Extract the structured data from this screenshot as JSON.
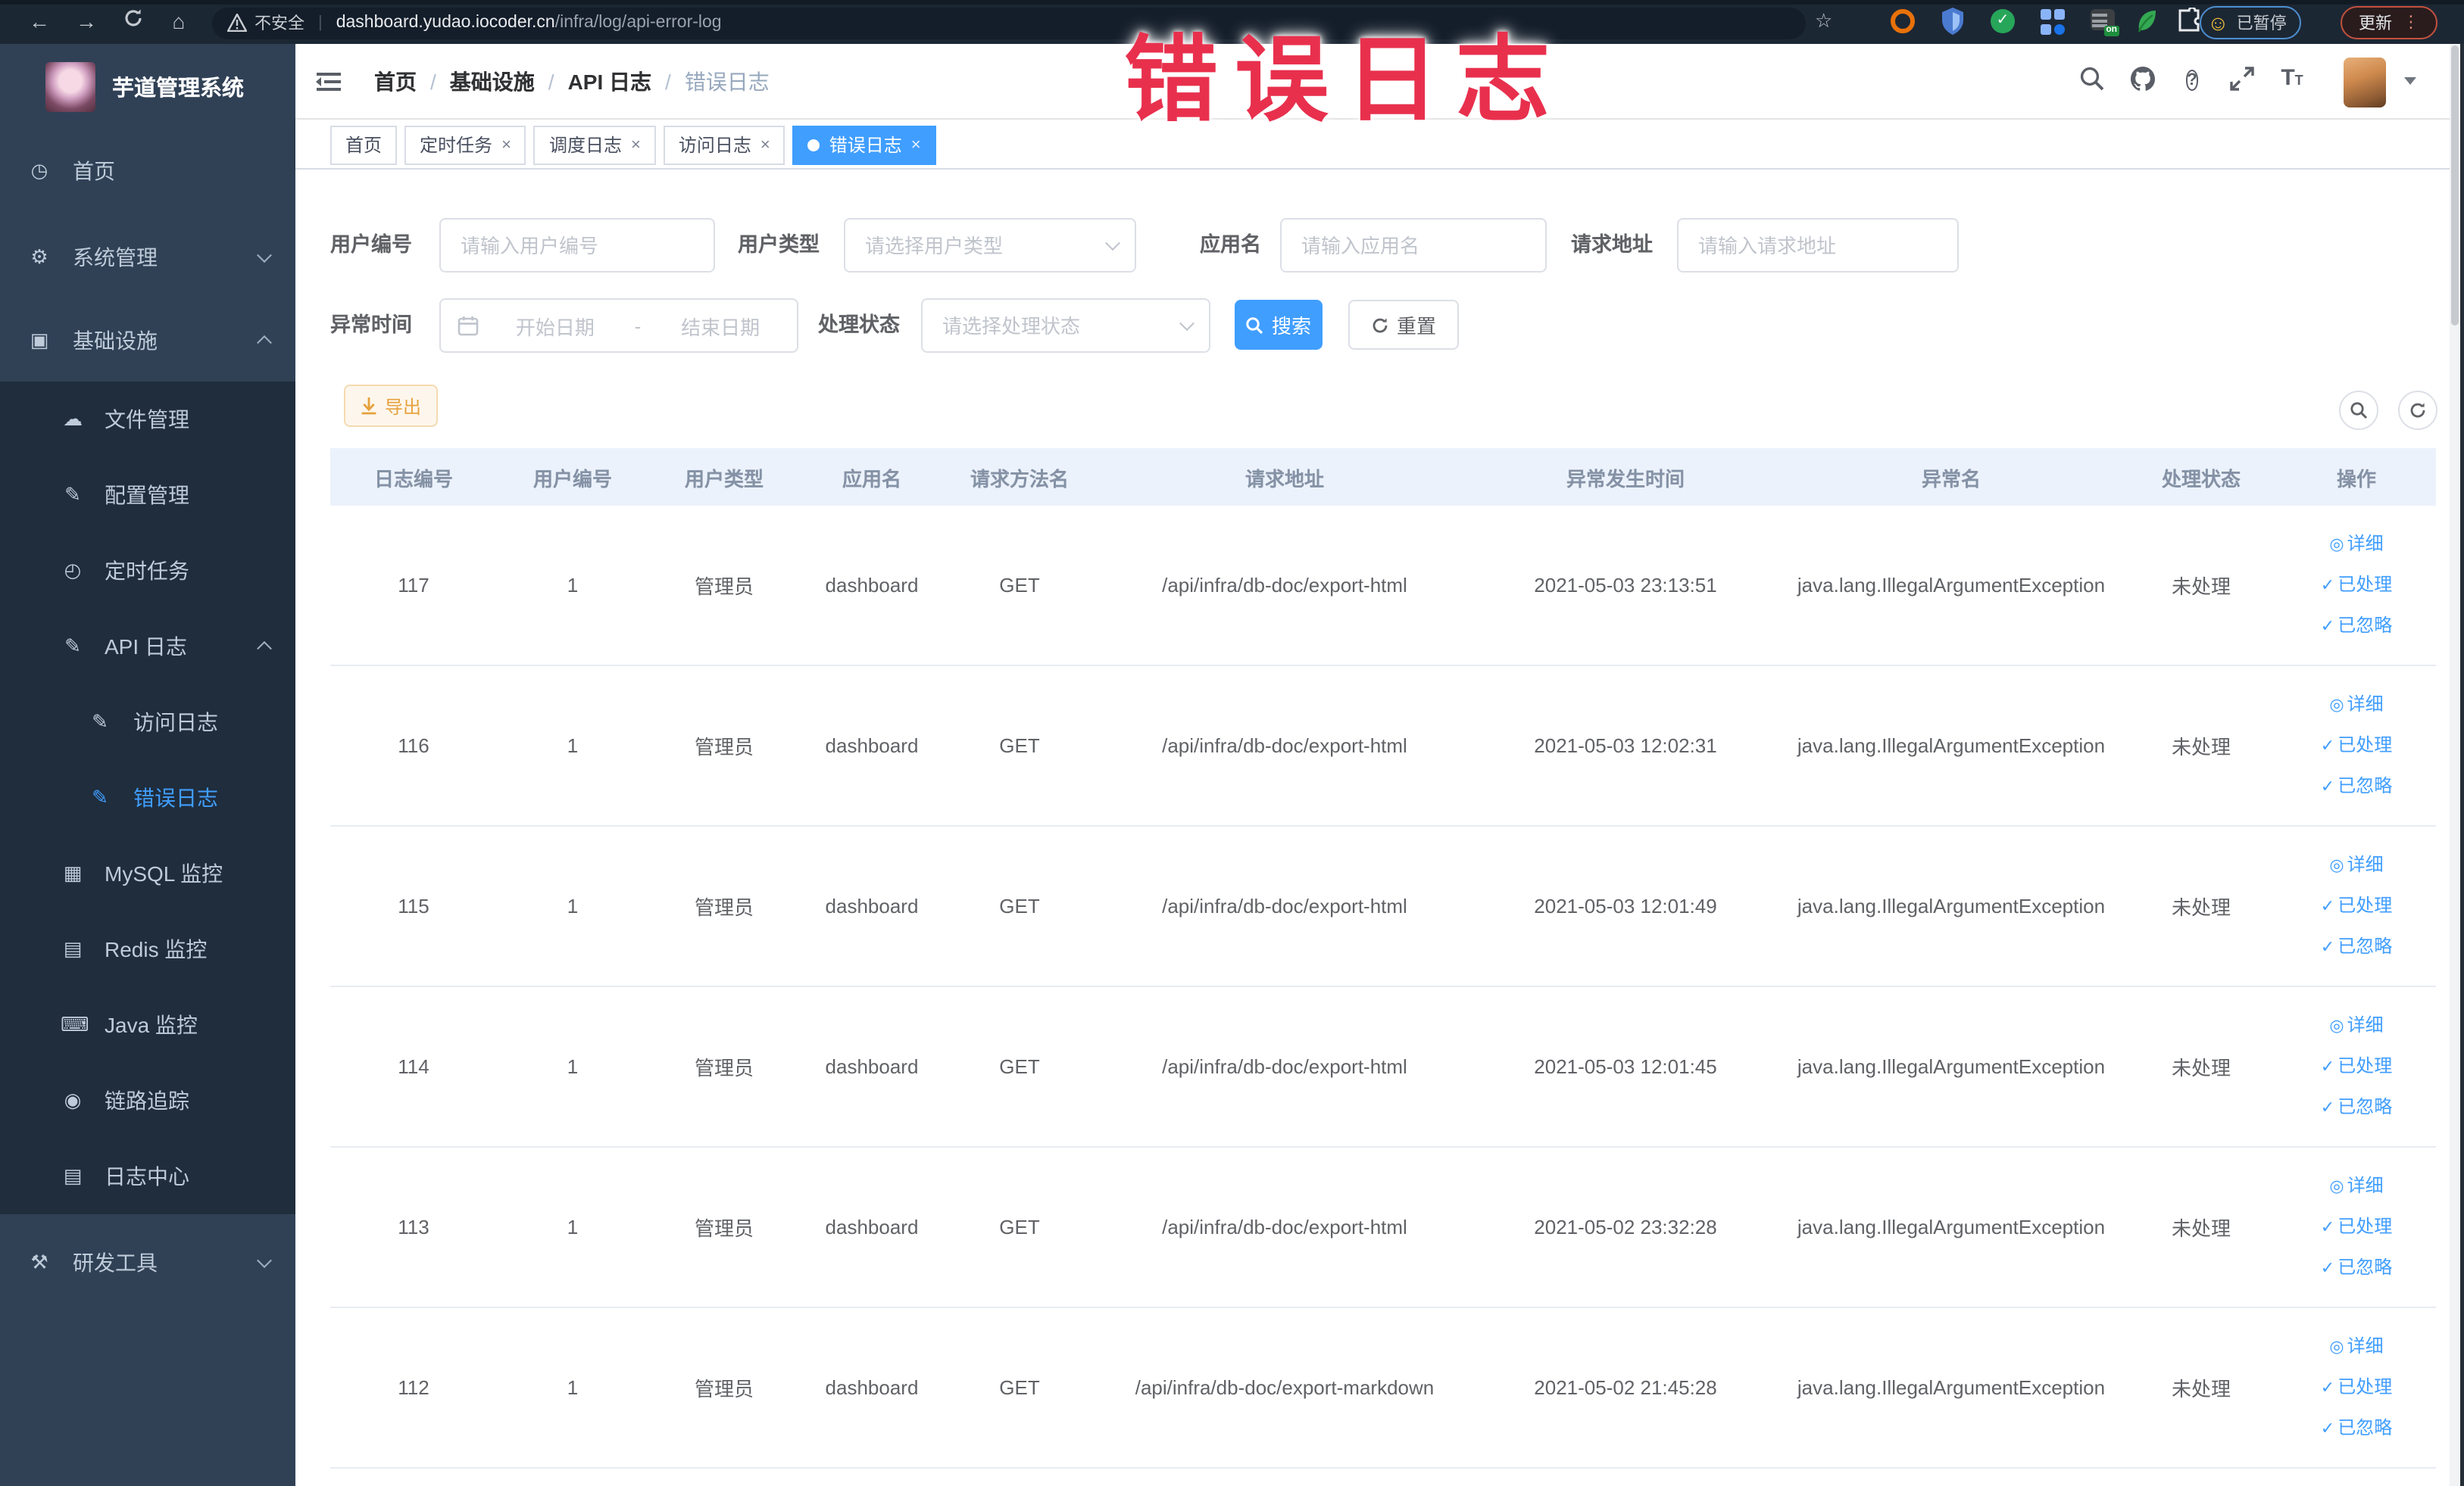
{
  "colors": {
    "accent": "#409EFF",
    "warning": "#E6A23C",
    "annotation_red": "#E8304D",
    "sidebar_bg": "#304156",
    "sidebar_submenu_bg": "#1F2D3D",
    "chrome_bg": "#1C2734"
  },
  "glyphs": {
    "back": "←",
    "forward": "→",
    "home": "⌂",
    "star": "☆",
    "smiley": "☺",
    "kebab": "⋮",
    "question": "?",
    "t_large": "T",
    "t_small": "T",
    "detail_icon": "◎",
    "check_icon": "✓"
  },
  "browser": {
    "security_label": "不安全",
    "url_domain": "dashboard.yudao.iocoder.cn",
    "url_path": "/infra/log/api-error-log",
    "profile_status": "已暂停",
    "update_label": "更新"
  },
  "annotation": {
    "text": "错误日志"
  },
  "sidebar": {
    "title": "芋道管理系统",
    "items": [
      {
        "label": "首页",
        "glyph": "◷"
      },
      {
        "label": "系统管理",
        "glyph": "⚙"
      },
      {
        "label": "基础设施",
        "glyph": "▣"
      },
      {
        "label": "文件管理",
        "glyph": "☁"
      },
      {
        "label": "配置管理",
        "glyph": "✎"
      },
      {
        "label": "定时任务",
        "glyph": "◴"
      },
      {
        "label": "API 日志",
        "glyph": "✎"
      },
      {
        "label": "访问日志",
        "glyph": "✎"
      },
      {
        "label": "错误日志",
        "glyph": "✎"
      },
      {
        "label": "MySQL 监控",
        "glyph": "▦"
      },
      {
        "label": "Redis 监控",
        "glyph": "▤"
      },
      {
        "label": "Java 监控",
        "glyph": "⌨"
      },
      {
        "label": "链路追踪",
        "glyph": "◉"
      },
      {
        "label": "日志中心",
        "glyph": "▤"
      },
      {
        "label": "研发工具",
        "glyph": "⚒"
      }
    ]
  },
  "breadcrumb": {
    "separator": "/",
    "items": [
      "首页",
      "基础设施",
      "API 日志",
      "错误日志"
    ]
  },
  "tabs": [
    {
      "label": "首页"
    },
    {
      "label": "定时任务"
    },
    {
      "label": "调度日志"
    },
    {
      "label": "访问日志"
    },
    {
      "label": "错误日志"
    }
  ],
  "filters": {
    "user_id": {
      "label": "用户编号",
      "placeholder": "请输入用户编号"
    },
    "user_type": {
      "label": "用户类型",
      "placeholder": "请选择用户类型"
    },
    "app_name": {
      "label": "应用名",
      "placeholder": "请输入应用名"
    },
    "request_url": {
      "label": "请求地址",
      "placeholder": "请输入请求地址"
    },
    "exception_time": {
      "label": "异常时间",
      "start_placeholder": "开始日期",
      "separator": "-",
      "end_placeholder": "结束日期"
    },
    "process_status": {
      "label": "处理状态",
      "placeholder": "请选择处理状态"
    },
    "search_label": "搜索",
    "reset_label": "重置"
  },
  "toolbar": {
    "export_label": "导出"
  },
  "table": {
    "columns": [
      "日志编号",
      "用户编号",
      "用户类型",
      "应用名",
      "请求方法名",
      "请求地址",
      "异常发生时间",
      "异常名",
      "处理状态",
      "操作"
    ],
    "actions": {
      "detail": "详细",
      "processed": "已处理",
      "ignored": "已忽略"
    },
    "rows": [
      {
        "id": "117",
        "user": "1",
        "type": "管理员",
        "app": "dashboard",
        "method": "GET",
        "url": "/api/infra/db-doc/export-html",
        "time": "2021-05-03 23:13:51",
        "exception": "java.lang.IllegalArgumentException",
        "status": "未处理"
      },
      {
        "id": "116",
        "user": "1",
        "type": "管理员",
        "app": "dashboard",
        "method": "GET",
        "url": "/api/infra/db-doc/export-html",
        "time": "2021-05-03 12:02:31",
        "exception": "java.lang.IllegalArgumentException",
        "status": "未处理"
      },
      {
        "id": "115",
        "user": "1",
        "type": "管理员",
        "app": "dashboard",
        "method": "GET",
        "url": "/api/infra/db-doc/export-html",
        "time": "2021-05-03 12:01:49",
        "exception": "java.lang.IllegalArgumentException",
        "status": "未处理"
      },
      {
        "id": "114",
        "user": "1",
        "type": "管理员",
        "app": "dashboard",
        "method": "GET",
        "url": "/api/infra/db-doc/export-html",
        "time": "2021-05-03 12:01:45",
        "exception": "java.lang.IllegalArgumentException",
        "status": "未处理"
      },
      {
        "id": "113",
        "user": "1",
        "type": "管理员",
        "app": "dashboard",
        "method": "GET",
        "url": "/api/infra/db-doc/export-html",
        "time": "2021-05-02 23:32:28",
        "exception": "java.lang.IllegalArgumentException",
        "status": "未处理"
      },
      {
        "id": "112",
        "user": "1",
        "type": "管理员",
        "app": "dashboard",
        "method": "GET",
        "url": "/api/infra/db-doc/export-markdown",
        "time": "2021-05-02 21:45:28",
        "exception": "java.lang.IllegalArgumentException",
        "status": "未处理"
      }
    ]
  }
}
